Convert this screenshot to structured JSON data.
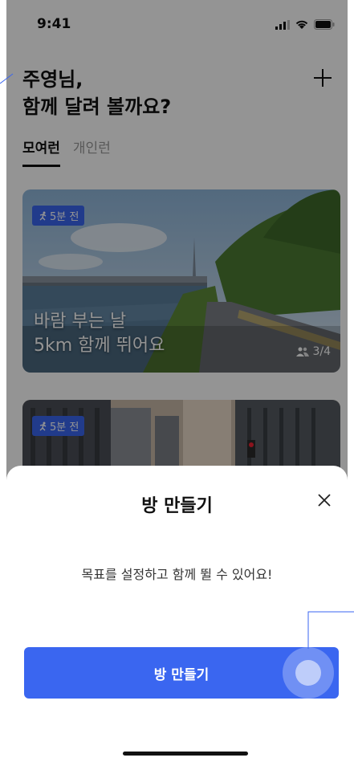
{
  "status_bar": {
    "time": "9:41"
  },
  "header": {
    "greeting_line1": "주영님,",
    "greeting_line2": "함께 달려 볼까요?"
  },
  "tabs": [
    {
      "label": "모여런",
      "active": true
    },
    {
      "label": "개인런",
      "active": false
    }
  ],
  "cards": [
    {
      "badge": "5분 전",
      "title_line1": "바람 부는 날",
      "title_line2": "5km 함께 뛰어요",
      "members": "3/4"
    },
    {
      "badge": "5분 전"
    }
  ],
  "sheet": {
    "title": "방 만들기",
    "description": "목표를 설정하고 함께 뛸 수 있어요!",
    "cta_label": "방 만들기"
  },
  "colors": {
    "accent": "#3a66f0",
    "overlay": "rgba(0,0,0,0.42)"
  }
}
